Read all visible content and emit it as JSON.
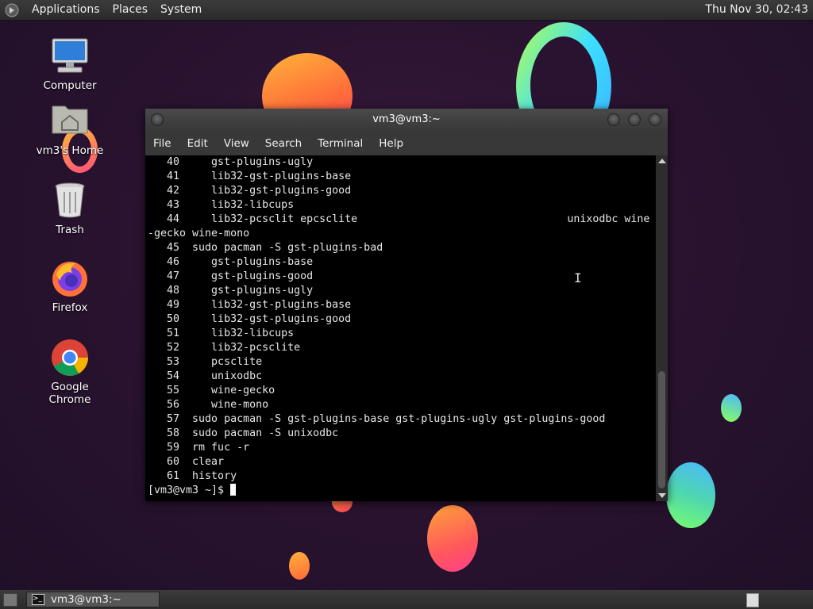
{
  "top_panel": {
    "menus": [
      "Applications",
      "Places",
      "System"
    ],
    "clock": "Thu Nov 30, 02:43"
  },
  "desktop_icons": [
    {
      "label": "Computer",
      "icon": "computer-icon"
    },
    {
      "label": "vm3's Home",
      "icon": "home-folder-icon"
    },
    {
      "label": "Trash",
      "icon": "trash-icon"
    },
    {
      "label": "Firefox",
      "icon": "firefox-icon"
    },
    {
      "label": "Google Chrome",
      "icon": "chrome-icon"
    }
  ],
  "terminal": {
    "title": "vm3@vm3:~",
    "menus": [
      "File",
      "Edit",
      "View",
      "Search",
      "Terminal",
      "Help"
    ],
    "lines": [
      "   40     gst-plugins-ugly",
      "   41     lib32-gst-plugins-base",
      "   42     lib32-gst-plugins-good",
      "   43     lib32-libcups",
      "   44     lib32-pcsclit epcsclite                                 unixodbc wine",
      "-gecko wine-mono",
      "   45  sudo pacman -S gst-plugins-bad",
      "   46     gst-plugins-base",
      "   47     gst-plugins-good",
      "   48     gst-plugins-ugly",
      "   49     lib32-gst-plugins-base",
      "   50     lib32-gst-plugins-good",
      "   51     lib32-libcups",
      "   52     lib32-pcsclite",
      "   53     pcsclite",
      "   54     unixodbc",
      "   55     wine-gecko",
      "   56     wine-mono",
      "   57  sudo pacman -S gst-plugins-base gst-plugins-ugly gst-plugins-good",
      "   58  sudo pacman -S unixodbc",
      "   59  rm fuc -r",
      "   60  clear",
      "   61  history"
    ],
    "prompt": "[vm3@vm3 ~]$ "
  },
  "bottom_panel": {
    "task_label": "vm3@vm3:~"
  }
}
